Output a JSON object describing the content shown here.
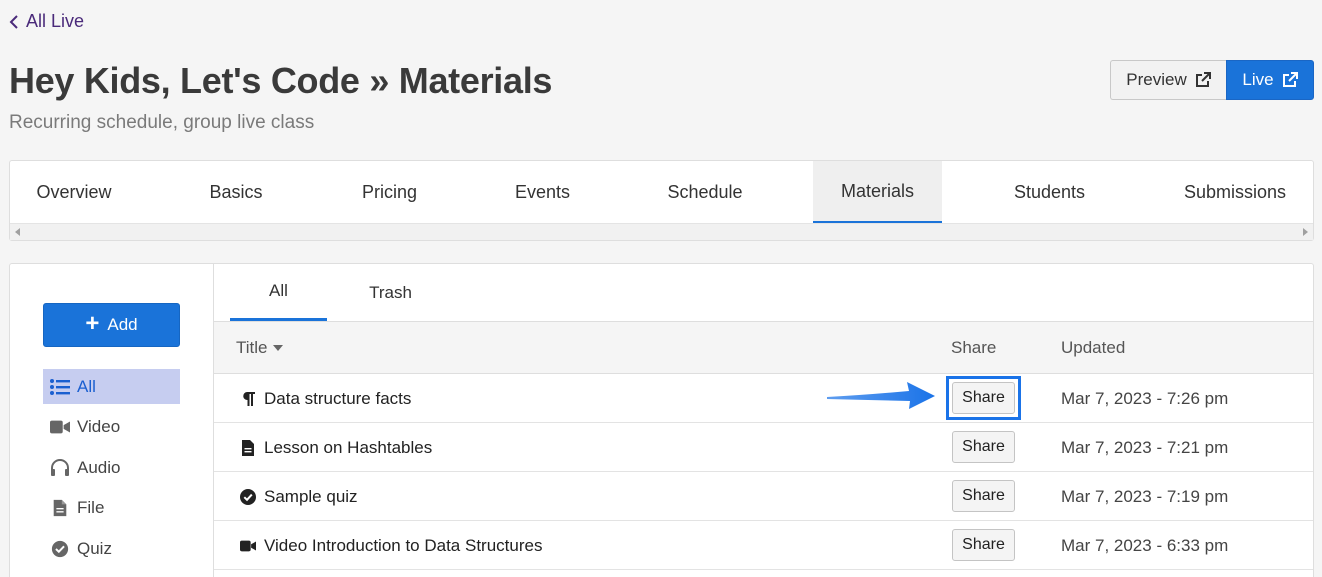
{
  "back_link": {
    "label": "All Live"
  },
  "header": {
    "title": "Hey Kids, Let's Code » Materials",
    "subtitle": "Recurring schedule, group live class",
    "preview_label": "Preview",
    "live_label": "Live"
  },
  "tabs": [
    {
      "label": "Overview",
      "active": false
    },
    {
      "label": "Basics",
      "active": false
    },
    {
      "label": "Pricing",
      "active": false
    },
    {
      "label": "Events",
      "active": false
    },
    {
      "label": "Schedule",
      "active": false
    },
    {
      "label": "Materials",
      "active": true
    },
    {
      "label": "Students",
      "active": false
    },
    {
      "label": "Submissions",
      "active": false
    }
  ],
  "sidebar": {
    "add_label": "Add",
    "items": [
      {
        "label": "All",
        "icon": "list-icon",
        "active": true
      },
      {
        "label": "Video",
        "icon": "video-camera-icon",
        "active": false
      },
      {
        "label": "Audio",
        "icon": "headphones-icon",
        "active": false
      },
      {
        "label": "File",
        "icon": "file-icon",
        "active": false
      },
      {
        "label": "Quiz",
        "icon": "check-circle-icon",
        "active": false
      }
    ]
  },
  "subtabs": [
    {
      "label": "All",
      "active": true
    },
    {
      "label": "Trash",
      "active": false
    }
  ],
  "table": {
    "columns": {
      "title": "Title",
      "share": "Share",
      "updated": "Updated"
    },
    "rows": [
      {
        "title": "Data structure facts",
        "icon": "paragraph-icon",
        "share_label": "Share",
        "updated": "Mar 7, 2023 - 7:26 pm",
        "highlighted": true
      },
      {
        "title": "Lesson on Hashtables",
        "icon": "document-icon",
        "share_label": "Share",
        "updated": "Mar 7, 2023 - 7:21 pm",
        "highlighted": false
      },
      {
        "title": "Sample quiz",
        "icon": "check-circle-icon",
        "share_label": "Share",
        "updated": "Mar 7, 2023 - 7:19 pm",
        "highlighted": false
      },
      {
        "title": "Video Introduction to Data Structures",
        "icon": "video-camera-icon",
        "share_label": "Share",
        "updated": "Mar 7, 2023 - 6:33 pm",
        "highlighted": false
      }
    ]
  },
  "colors": {
    "primary_blue": "#1a73d9",
    "active_sidebar_bg": "#c6cdf0",
    "back_link": "#4a2a7a",
    "annotation_arrow": "#1a73e8"
  }
}
